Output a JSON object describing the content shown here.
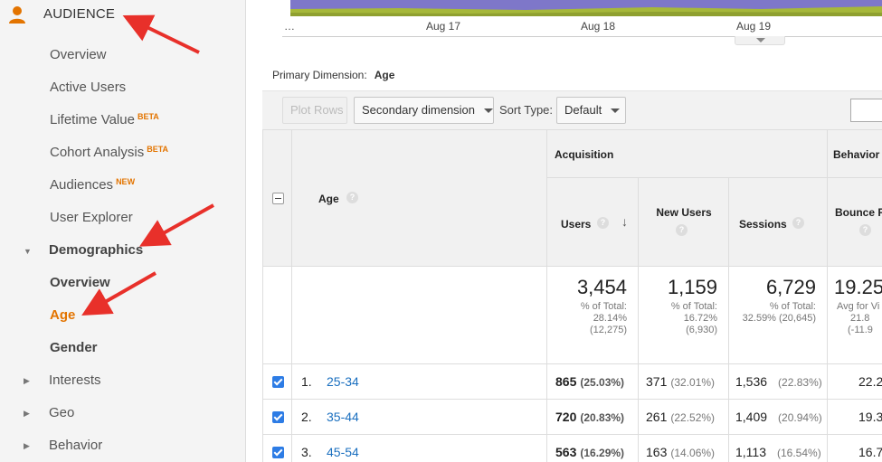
{
  "sidebar": {
    "section_title": "AUDIENCE",
    "items": [
      {
        "label": "Overview"
      },
      {
        "label": "Active Users"
      },
      {
        "label": "Lifetime Value",
        "badge": "BETA"
      },
      {
        "label": "Cohort Analysis",
        "badge": "BETA"
      },
      {
        "label": "Audiences",
        "badge": "NEW"
      },
      {
        "label": "User Explorer"
      },
      {
        "label": "Demographics"
      },
      {
        "label": "Overview"
      },
      {
        "label": "Age"
      },
      {
        "label": "Gender"
      },
      {
        "label": "Interests"
      },
      {
        "label": "Geo"
      },
      {
        "label": "Behavior"
      }
    ]
  },
  "chart": {
    "x_ticks": [
      "…",
      "Aug 17",
      "Aug 18",
      "Aug 19"
    ],
    "fill_color": "#7e77c9",
    "band_color": "#a6b83a"
  },
  "primary_dimension": {
    "label": "Primary Dimension:",
    "value": "Age"
  },
  "toolbar": {
    "plot_rows": "Plot Rows",
    "secondary_dimension": "Secondary dimension",
    "sort_type_label": "Sort Type:",
    "sort_type_value": "Default"
  },
  "table": {
    "group_headers": {
      "acquisition": "Acquisition",
      "behavior": "Behavior"
    },
    "columns": {
      "dimension": "Age",
      "users": "Users",
      "new_users": "New Users",
      "sessions": "Sessions",
      "bounce_rate": "Bounce R"
    },
    "totals": {
      "users": {
        "value": "3,454",
        "line1": "% of Total:",
        "line2": "28.14%",
        "line3": "(12,275)"
      },
      "new_users": {
        "value": "1,159",
        "line1": "% of Total:",
        "line2": "16.72%",
        "line3": "(6,930)"
      },
      "sessions": {
        "value": "6,729",
        "line1": "% of Total:",
        "line2": "32.59% (20,645)",
        "line3": ""
      },
      "bounce_rate": {
        "value": "19.25",
        "line1": "Avg for Vi",
        "line2": "21.8",
        "line3": "(-11.9"
      }
    },
    "rows": [
      {
        "num": "1.",
        "age": "25-34",
        "users": "865",
        "users_pct": "(25.03%)",
        "new_users": "371",
        "new_users_pct": "(32.01%)",
        "sessions": "1,536",
        "sessions_pct": "(22.83%)",
        "bounce": "22.2"
      },
      {
        "num": "2.",
        "age": "35-44",
        "users": "720",
        "users_pct": "(20.83%)",
        "new_users": "261",
        "new_users_pct": "(22.52%)",
        "sessions": "1,409",
        "sessions_pct": "(20.94%)",
        "bounce": "19.3"
      },
      {
        "num": "3.",
        "age": "45-54",
        "users": "563",
        "users_pct": "(16.29%)",
        "new_users": "163",
        "new_users_pct": "(14.06%)",
        "sessions": "1,113",
        "sessions_pct": "(16.54%)",
        "bounce": "16.7"
      }
    ]
  },
  "colors": {
    "accent": "#e37400",
    "link": "#1a6fbf",
    "checkbox": "#2d7ce5",
    "arrow": "#e8302a"
  }
}
